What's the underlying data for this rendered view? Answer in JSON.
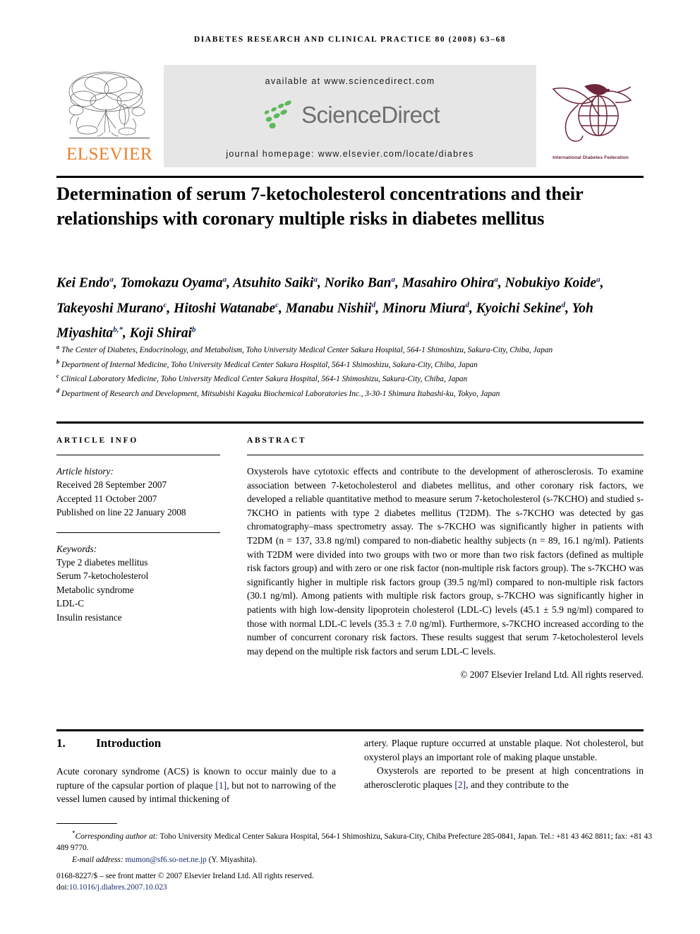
{
  "running_head": "diabetes research and clinical practice 80 (2008) 63–68",
  "banner": {
    "available_at": "available at www.sciencedirect.com",
    "sciencedirect_label": "ScienceDirect",
    "journal_homepage": "journal homepage: www.elsevier.com/locate/diabres",
    "elsevier_wordmark": "ELSEVIER",
    "idf_caption": "International Diabetes Federation",
    "colors": {
      "band_background": "#e6e6e6",
      "elsevier_orange": "#ec7d26",
      "sciencedirect_green": "#5cb85c",
      "sciencedirect_grey": "#6d6e71",
      "idf_maroon": "#6e2639"
    }
  },
  "title": "Determination of serum 7-ketocholesterol concentrations and their relationships with coronary multiple risks in diabetes mellitus",
  "authors_html": "Kei Endo<sup>a</sup>, Tomokazu Oyama<sup>a</sup>, Atsuhito Saiki<sup>a</sup>, Noriko Ban<sup>a</sup>, Masahiro Ohira<sup>a</sup>, Nobukiyo Koide<sup>a</sup>, Takeyoshi Murano<sup>c</sup>, Hitoshi Watanabe<sup>c</sup>, Manabu Nishii<sup>d</sup>, Minoru Miura<sup>d</sup>, Kyoichi Sekine<sup>d</sup>, Yoh Miyashita<sup>b,*</sup>, Koji Shirai<sup>b</sup>",
  "affiliations": [
    {
      "mark": "a",
      "text": "The Center of Diabetes, Endocrinology, and Metabolism, Toho University Medical Center Sakura Hospital, 564-1 Shimoshizu, Sakura-City, Chiba, Japan"
    },
    {
      "mark": "b",
      "text": "Department of Internal Medicine, Toho University Medical Center Sakura Hospital, 564-1 Shimoshizu, Sakura-City, Chiba, Japan"
    },
    {
      "mark": "c",
      "text": "Clinical Laboratory Medicine, Toho University Medical Center Sakura Hospital, 564-1 Shimoshizu, Sakura-City, Chiba, Japan"
    },
    {
      "mark": "d",
      "text": "Department of Research and Development, Mitsubishi Kagaku Biochemical Laboratories Inc., 3-30-1 Shimura Itabashi-ku, Tokyo, Japan"
    }
  ],
  "article_info": {
    "heading": "ARTICLE INFO",
    "history_label": "Article history:",
    "history": [
      "Received 28 September 2007",
      "Accepted 11 October 2007",
      "Published on line 22 January 2008"
    ],
    "keywords_label": "Keywords:",
    "keywords": [
      "Type 2 diabetes mellitus",
      "Serum 7-ketocholesterol",
      "Metabolic syndrome",
      "LDL-C",
      "Insulin resistance"
    ]
  },
  "abstract": {
    "heading": "ABSTRACT",
    "text": "Oxysterols have cytotoxic effects and contribute to the development of atherosclerosis. To examine association between 7-ketocholesterol and diabetes mellitus, and other coronary risk factors, we developed a reliable quantitative method to measure serum 7-ketocholesterol (s-7KCHO) and studied s-7KCHO in patients with type 2 diabetes mellitus (T2DM). The s-7KCHO was detected by gas chromatography–mass spectrometry assay. The s-7KCHO was significantly higher in patients with T2DM (n = 137, 33.8 ng/ml) compared to non-diabetic healthy subjects (n = 89, 16.1 ng/ml). Patients with T2DM were divided into two groups with two or more than two risk factors (defined as multiple risk factors group) and with zero or one risk factor (non-multiple risk factors group). The s-7KCHO was significantly higher in multiple risk factors group (39.5 ng/ml) compared to non-multiple risk factors (30.1 ng/ml). Among patients with multiple risk factors group, s-7KCHO was significantly higher in patients with high low-density lipoprotein cholesterol (LDL-C) levels (45.1 ± 5.9 ng/ml) compared to those with normal LDL-C levels (35.3 ± 7.0 ng/ml). Furthermore, s-7KCHO increased according to the number of concurrent coronary risk factors. These results suggest that serum 7-ketocholesterol levels may depend on the multiple risk factors and serum LDL-C levels.",
    "copyright": "© 2007 Elsevier Ireland Ltd. All rights reserved."
  },
  "introduction": {
    "number": "1.",
    "title": "Introduction",
    "left_paragraph_pre": "Acute coronary syndrome (ACS) is known to occur mainly due to a rupture of the capsular portion of plaque ",
    "left_ref": "[1]",
    "left_paragraph_post": ", but not to narrowing of the vessel lumen caused by intimal thickening of",
    "right_paragraph_1": "artery. Plaque rupture occurred at unstable plaque. Not cholesterol, but oxysterol plays an important role of making plaque unstable.",
    "right_paragraph_2_pre": "Oxysterols are reported to be present at high concentrations in atherosclerotic plaques ",
    "right_ref": "[2]",
    "right_paragraph_2_post": ", and they contribute to the"
  },
  "footnotes": {
    "star": "*",
    "corresponding_label": "Corresponding author at:",
    "corresponding_text": " Toho University Medical Center Sakura Hospital, 564-1 Shimoshizu, Sakura-City, Chiba Prefecture 285-0841, Japan. Tel.: +81 43 462 8811; fax: +81 43 489 9770.",
    "email_label": "E-mail address:",
    "email": "mumon@sf6.so-net.ne.jp",
    "email_suffix": " (Y. Miyashita).",
    "front_matter": "0168-8227/$ – see front matter © 2007 Elsevier Ireland Ltd. All rights reserved.",
    "doi_label": "doi:",
    "doi": "10.1016/j.diabres.2007.10.023"
  }
}
